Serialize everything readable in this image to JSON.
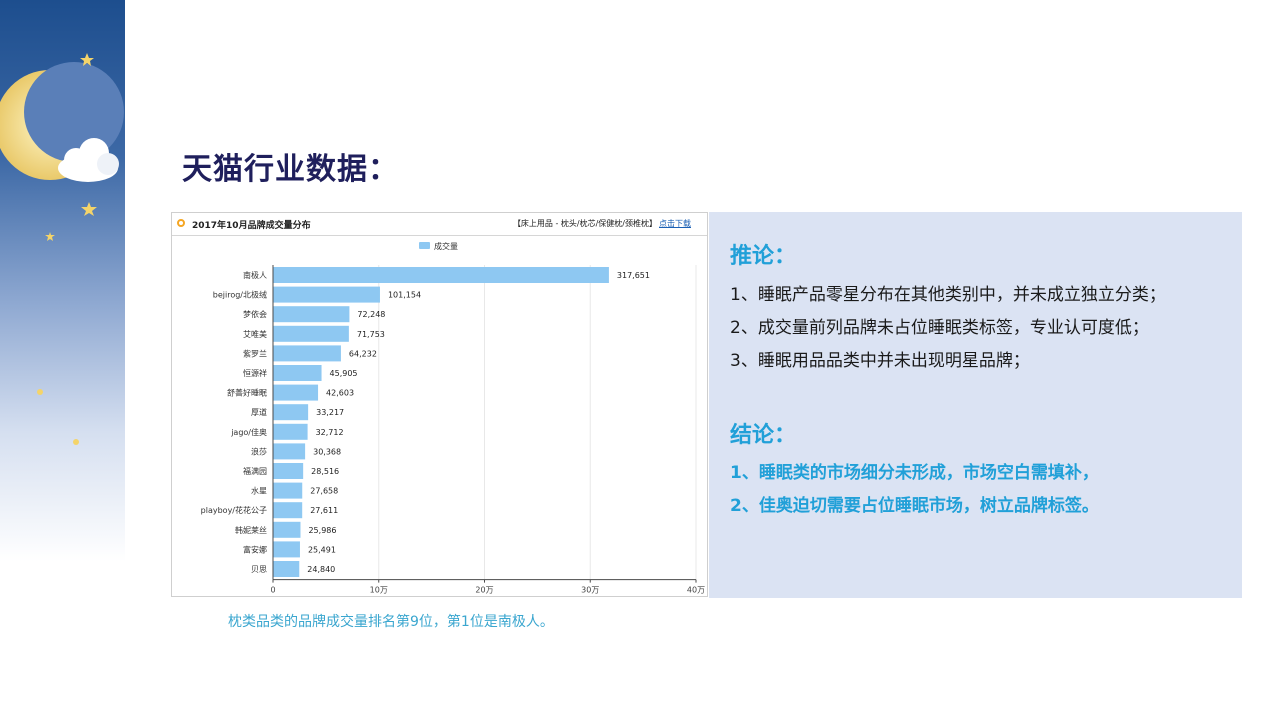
{
  "page": {
    "title": "天猫行业数据："
  },
  "chart_panel": {
    "title": "2017年10月品牌成交量分布",
    "breadcrumb": "【床上用品 - 枕头/枕芯/保健枕/颈椎枕】",
    "download_link": "点击下载"
  },
  "chart_data": {
    "type": "bar",
    "orientation": "horizontal",
    "title": "2017年10月品牌成交量分布",
    "legend": [
      "成交量"
    ],
    "legend_position": "top",
    "categories": [
      "南极人",
      "bejirog/北极绒",
      "梦依会",
      "艾唯美",
      "紫罗兰",
      "恒源祥",
      "舒善好睡眠",
      "厚道",
      "jago/佳奥",
      "浪莎",
      "福满园",
      "水星",
      "playboy/花花公子",
      "韩妮莱丝",
      "富安娜",
      "贝思"
    ],
    "series": [
      {
        "name": "成交量",
        "values": [
          317651,
          101154,
          72248,
          71753,
          64232,
          45905,
          42603,
          33217,
          32712,
          30368,
          28516,
          27658,
          27611,
          25986,
          25491,
          24840
        ]
      }
    ],
    "value_labels": [
      "317,651",
      "101,154",
      "72,248",
      "71,753",
      "64,232",
      "45,905",
      "42,603",
      "33,217",
      "32,712",
      "30,368",
      "28,516",
      "27,658",
      "27,611",
      "25,986",
      "25,491",
      "24,840"
    ],
    "xlim": [
      0,
      400000
    ],
    "x_ticks": [
      0,
      100000,
      200000,
      300000,
      400000
    ],
    "x_tick_labels": [
      "0",
      "10万",
      "20万",
      "30万",
      "40万"
    ],
    "grid": true,
    "bar_color": "#8ec8f2"
  },
  "caption": "枕类品类的品牌成交量排名第9位，第1位是南极人。",
  "analysis": {
    "inference_title": "推论：",
    "inferences": [
      "1、睡眠产品零星分布在其他类别中，并未成立独立分类；",
      "2、成交量前列品牌未占位睡眠类标签，专业认可度低；",
      "3、睡眠用品品类中并未出现明星品牌；"
    ],
    "conclusion_title": "结论：",
    "conclusions": [
      "1、睡眠类的市场细分未形成，市场空白需填补，",
      "2、佳奥迫切需要占位睡眠市场，树立品牌标签。"
    ]
  },
  "colors": {
    "title": "#1f1f5c",
    "accent": "#21a0d8",
    "panel_bg": "#dbe3f3",
    "caption": "#3aa6cf"
  }
}
